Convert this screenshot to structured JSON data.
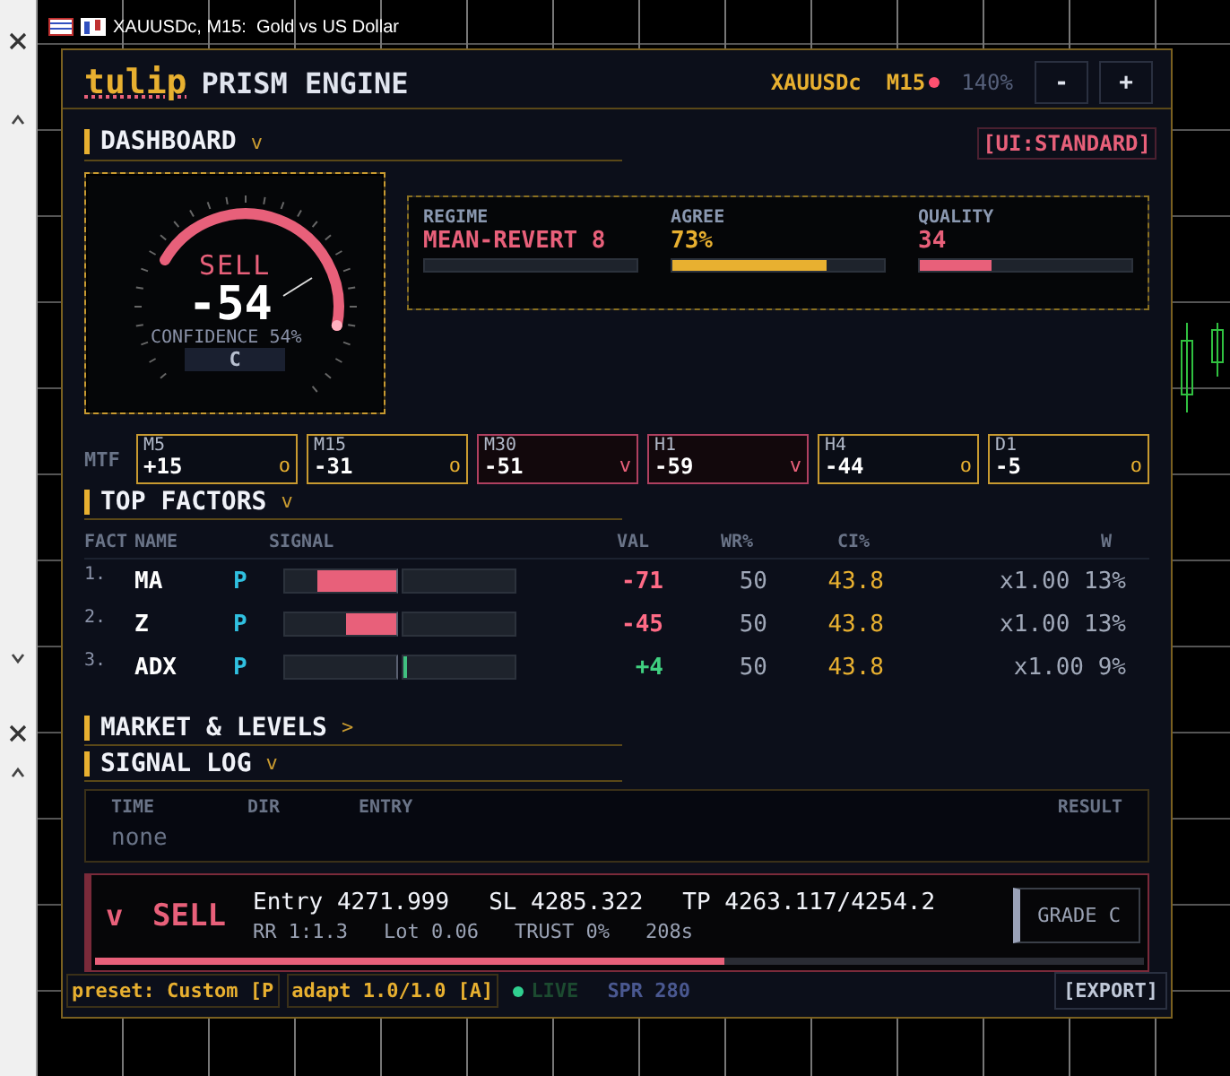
{
  "chart_window": {
    "title": "XAUUSDc, M15:  Gold vs US Dollar"
  },
  "header": {
    "logo": "tulip",
    "title": "PRISM ENGINE",
    "symbol": "XAUUSDc",
    "timeframe": "M15",
    "live_dot": true,
    "zoom": "140%",
    "buttons": [
      "-",
      "+"
    ]
  },
  "dashboard": {
    "title": "DASHBOARD",
    "toggle": "v",
    "ui_mode": "[UI:STANDARD]",
    "gauge": {
      "direction": "SELL",
      "score": "-54",
      "confidence": "CONFIDENCE 54%",
      "grade": "C"
    },
    "stats": [
      {
        "label": "REGIME",
        "value": "MEAN-REVERT 8",
        "color": "#e8607a"
      },
      {
        "label": "AGREE",
        "value": "73%",
        "level": 0.73,
        "color": "#e8b030"
      },
      {
        "label": "QUALITY",
        "value": "34",
        "level": 0.34,
        "color": "#e8607a"
      }
    ]
  },
  "mtf": {
    "label": "MTF",
    "frames": [
      {
        "name": "M5",
        "value": "+15",
        "mark": "o",
        "kind": "neutral"
      },
      {
        "name": "M15",
        "value": "-31",
        "mark": "o",
        "kind": "neutral"
      },
      {
        "name": "M30",
        "value": "-51",
        "mark": "v",
        "kind": "bearish"
      },
      {
        "name": "H1",
        "value": "-59",
        "mark": "v",
        "kind": "bearish"
      },
      {
        "name": "H4",
        "value": "-44",
        "mark": "o",
        "kind": "neutral"
      },
      {
        "name": "D1",
        "value": "-5",
        "mark": "o",
        "kind": "neutral"
      }
    ]
  },
  "top_factors": {
    "title": "TOP FACTORS",
    "toggle": "v",
    "columns": [
      "FACT",
      "NAME",
      "SIGNAL",
      "VAL",
      "WR%",
      "CI%",
      "W"
    ],
    "rows": [
      {
        "index": "1.",
        "name": "MA",
        "tag": "P",
        "kind": "negative",
        "level": 0.71,
        "value": "-71",
        "wr": "50",
        "ci": "43.8",
        "weight": "x1.00 13%"
      },
      {
        "index": "2.",
        "name": "Z",
        "tag": "P",
        "kind": "negative",
        "level": 0.45,
        "value": "-45",
        "wr": "50",
        "ci": "43.8",
        "weight": "x1.00 13%"
      },
      {
        "index": "3.",
        "name": "ADX",
        "tag": "P",
        "kind": "positive",
        "level": 0.04,
        "value": "+4",
        "wr": "50",
        "ci": "43.8",
        "weight": "x1.00 9%"
      }
    ]
  },
  "market_levels": {
    "title": "MARKET & LEVELS",
    "toggle": ">"
  },
  "signal_log": {
    "title": "SIGNAL LOG",
    "toggle": "v",
    "columns": [
      "TIME",
      "DIR",
      "ENTRY",
      "RESULT"
    ],
    "empty": "none"
  },
  "signal": {
    "arrow": "v",
    "direction": "SELL",
    "entry": "Entry 4271.999",
    "sl": "SL 4285.322",
    "tp": "TP 4263.117/4254.2",
    "rr": "RR 1:1.3",
    "lot": "Lot 0.06",
    "trust": "TRUST 0%",
    "age": "208s",
    "grade": "GRADE C",
    "level": 0.6
  },
  "footer": {
    "preset": "preset: Custom [P",
    "adapt": "adapt 1.0/1.0 [A]",
    "live": "LIVE",
    "live_on": true,
    "spread": "SPR 280",
    "export": "[EXPORT]"
  }
}
